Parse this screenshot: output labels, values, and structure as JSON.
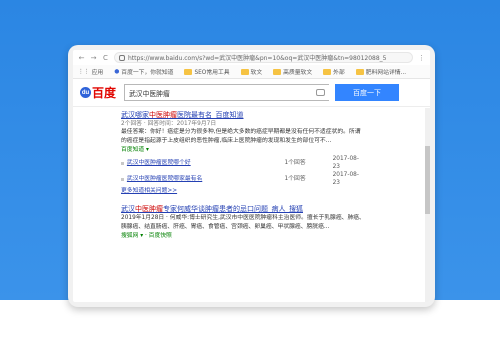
{
  "browser": {
    "back": "←",
    "forward": "→",
    "refresh": "C",
    "url": "https://www.baidu.com/s?wd=武汉中医肿瘤&pn=10&oq=武汉中医肿瘤&tn=98012088_5",
    "menu": "⋮"
  },
  "bookmarks": [
    {
      "label": "应用"
    },
    {
      "label": "百度一下，你就知道"
    },
    {
      "label": "SEO常用工具"
    },
    {
      "label": "软文"
    },
    {
      "label": "高质量软文"
    },
    {
      "label": "外部"
    },
    {
      "label": "肥料网站详情..."
    }
  ],
  "search": {
    "logo": "百度",
    "paw": "du",
    "query": "武汉中医肿瘤",
    "button": "百度一下"
  },
  "results": [
    {
      "title_before": "武汉哪家",
      "title_em": "中医肿瘤",
      "title_after": "医院最有名_百度知道",
      "meta": "2个回答 · 回答时间：2017年9月7日",
      "snippet": "最佳答案：你好！癌症是分为很多种,但是绝大多数的癌症早期都是没有任何不适症状的。所谓的癌症是指起源于上皮组织的恶性肿瘤,临床上医院肿瘤的发现和发生的部位可不...",
      "source": "百度知道 ▾",
      "rows": [
        {
          "text": "武汉中医肿瘤医院哪个好",
          "answers": "1个回答",
          "date": "2017-08-23"
        },
        {
          "text": "武汉中医肿瘤医院哪家最有名",
          "answers": "1个回答",
          "date": "2017-08-23"
        }
      ],
      "more": "更多知道相关问题>>"
    },
    {
      "title_before": "武汉",
      "title_em": "中医肿瘤",
      "title_after": "专家何威华谈肿瘤患者的忌口问题_病人_搜狐",
      "meta": "",
      "snippet": "2019年1月28日 · 何威华:博士研究生,武汉市中医医院肿瘤科主治医师。擅长于乳腺癌、肺癌、胰腺癌、结直肠癌、肝癌、胃癌、食管癌、宫颈癌、卵巢癌、甲状腺癌、膀胱癌...",
      "source": "搜狐网 ▾ · 百度快照",
      "rows": [],
      "more": ""
    }
  ]
}
